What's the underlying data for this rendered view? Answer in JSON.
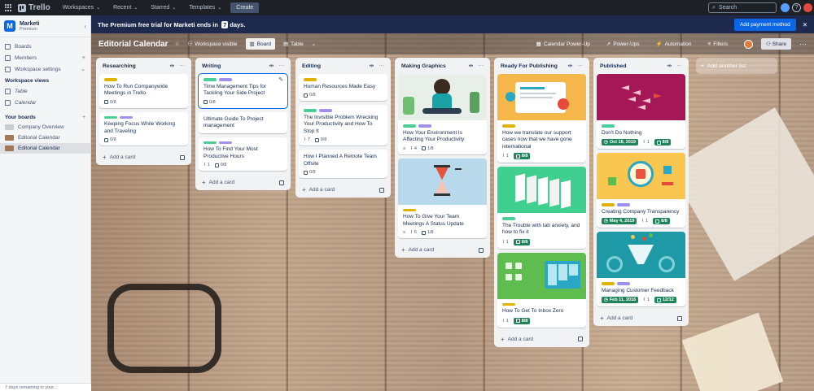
{
  "nav": {
    "logo": "Trello",
    "items": [
      "Workspaces",
      "Recent",
      "Starred",
      "Templates"
    ],
    "create": "Create",
    "search_placeholder": "Search"
  },
  "sidebar": {
    "workspace_initial": "M",
    "workspace_name": "Marketi",
    "workspace_plan": "Premium",
    "items": [
      {
        "label": "Boards"
      },
      {
        "label": "Members",
        "right": "+"
      },
      {
        "label": "Workspace settings",
        "right": "⌄"
      }
    ],
    "views_header": "Workspace views",
    "views": [
      {
        "label": "Table"
      },
      {
        "label": "Calendar"
      }
    ],
    "boards_header": "Your boards",
    "boards_add": "+",
    "boards": [
      {
        "label": "Company Overview"
      },
      {
        "label": "Editorial Calendar"
      },
      {
        "label": "Editorial Calendar"
      }
    ],
    "footer": "7 days remaining in your..."
  },
  "banner": {
    "text_before": "The Premium free trial for Marketi ends in",
    "days": "7",
    "text_after": "days.",
    "button": "Add payment method"
  },
  "board_header": {
    "title": "Editorial Calendar",
    "visibility": "Workspace visible",
    "view_board": "Board",
    "view_table": "Table",
    "calendar": "Calendar Power-Up",
    "powerups": "Power-Ups",
    "automation": "Automation",
    "filters": "Filters",
    "share": "Share"
  },
  "add_card_label": "Add a card",
  "add_list_label": "Add another list",
  "lists": [
    {
      "title": "Researching",
      "cards": [
        {
          "labels": [
            "yellow"
          ],
          "title": "How To Run Companywide Meetings in Trello",
          "checklist": "0/8"
        },
        {
          "labels": [
            "green",
            "purple"
          ],
          "title": "Keeping Focus While Working and Traveling",
          "checklist": "0/8"
        }
      ]
    },
    {
      "title": "Writing",
      "cards": [
        {
          "labels": [
            "green",
            "purple"
          ],
          "title": "Time Management Tips for Tackling Your Side Project",
          "checklist": "0/8"
        },
        {
          "labels": [],
          "title": "Ultimate Guide To Project management"
        },
        {
          "labels": [
            "green",
            "purple"
          ],
          "title": "How To Find Your Most Productive Hours",
          "attachments": "1",
          "checklist": "0/8"
        }
      ]
    },
    {
      "title": "Editing",
      "cards": [
        {
          "labels": [
            "yellow"
          ],
          "title": "Human Resources Made Easy",
          "checklist": "0/8"
        },
        {
          "labels": [
            "green",
            "purple"
          ],
          "title": "The Invisible Problem Wrecking Your Productivity and How To Stop It",
          "attachments": "7",
          "checklist": "0/8"
        },
        {
          "labels": [],
          "title": "How I Planned A Remote Team Offsite",
          "checklist": "0/8"
        }
      ]
    },
    {
      "title": "Making Graphics",
      "cards": [
        {
          "cover": "meditation",
          "labels": [
            "green",
            "purple"
          ],
          "title": "How Your Environment Is Affecting Your Productivity",
          "attachments": "4",
          "checklist": "1/8"
        },
        {
          "cover": "hourglass",
          "labels": [
            "yellow"
          ],
          "title": "How To Give Your Team Meetings A Status Update",
          "attachments": "6",
          "checklist": "1/8"
        }
      ]
    },
    {
      "title": "Ready For Publishing",
      "cards": [
        {
          "cover": "support",
          "labels": [
            "yellow"
          ],
          "title": "How we translate our support cases now that we have gone international",
          "attachments": "1",
          "checklist_done": "8/8"
        },
        {
          "cover": "tabs",
          "labels": [
            "green"
          ],
          "title": "The Trouble with tab anxiety, and how to fix it",
          "attachments": "1",
          "checklist_done": "8/8"
        },
        {
          "cover": "inbox",
          "labels": [
            "yellow"
          ],
          "title": "How To Get To Inbox Zero",
          "attachments": "1",
          "checklist_done": "8/8"
        }
      ]
    },
    {
      "title": "Published",
      "cards": [
        {
          "cover": "fish",
          "labels": [
            "green"
          ],
          "title": "Don't Do Nothing",
          "due": "Oct 18, 2019",
          "attachments": "1",
          "checklist_done": "8/8"
        },
        {
          "cover": "transparency",
          "labels": [
            "yellow",
            "purple"
          ],
          "title": "Creating Company Transparency",
          "due": "May 4, 2019",
          "attachments": "1",
          "checklist_done": "8/8"
        },
        {
          "cover": "feedback",
          "labels": [
            "yellow",
            "purple"
          ],
          "title": "Managing Customer Feedback",
          "due": "Feb 11, 2016",
          "attachments": "1",
          "checklist_done": "12/12"
        }
      ]
    }
  ],
  "colors": {
    "nav_bg": "#1d2125",
    "banner_bg": "#1d2a4d",
    "primary": "#0c66e4",
    "done_green": "#1f845a",
    "label_yellow": "#e2b203",
    "label_green": "#4bce97",
    "label_purple": "#9f8fef"
  }
}
